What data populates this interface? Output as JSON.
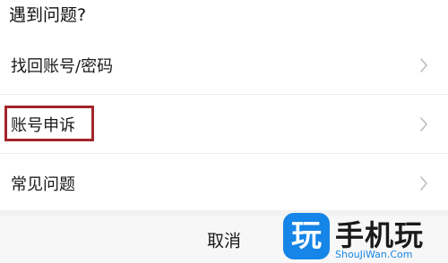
{
  "sheet": {
    "title": "遇到问题?",
    "items": [
      {
        "label": "找回账号/密码",
        "icon": "chevron-right-icon"
      },
      {
        "label": "账号申诉",
        "icon": "chevron-right-icon",
        "highlighted": true
      },
      {
        "label": "常见问题",
        "icon": "chevron-right-icon"
      }
    ],
    "cancel_label": "取消"
  },
  "highlight_color": "#a3262b",
  "watermark": {
    "logo_char": "玩",
    "name": "手机玩",
    "url": "ShouJiWan.Com",
    "accent_color": "#1685e8"
  }
}
